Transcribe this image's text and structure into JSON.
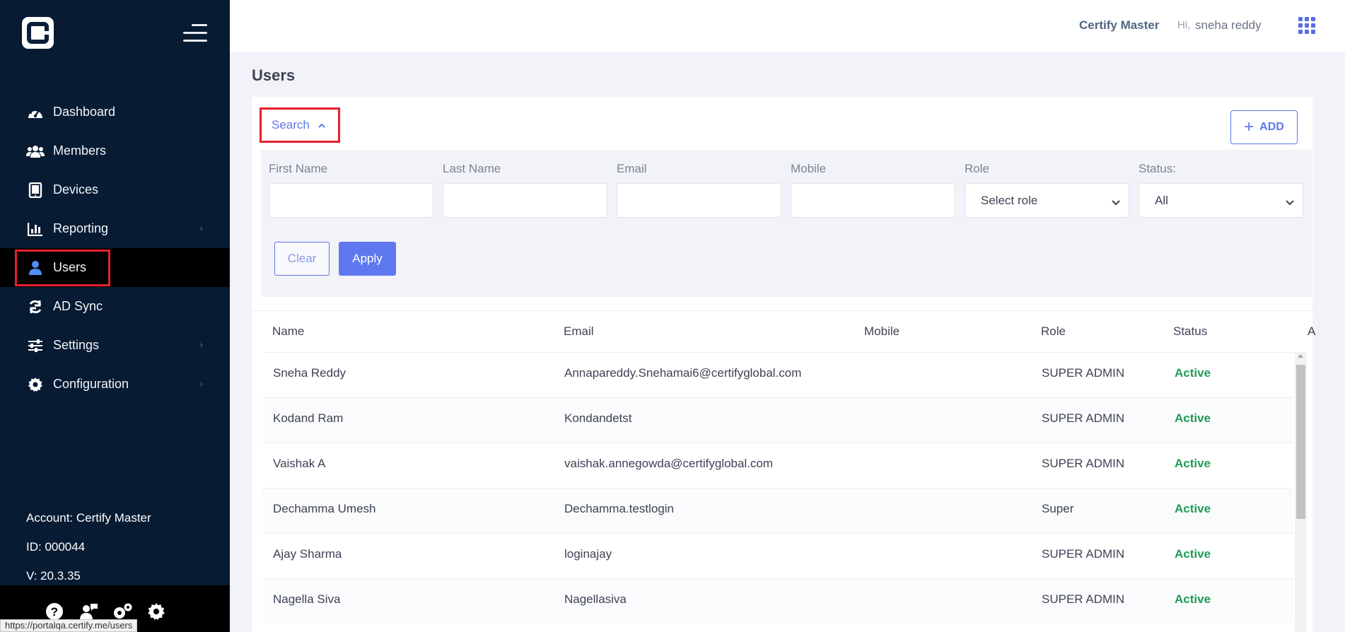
{
  "sidebar": {
    "items": [
      {
        "label": "Dashboard",
        "icon": "dashboard-icon",
        "chevron": false
      },
      {
        "label": "Members",
        "icon": "members-icon",
        "chevron": false
      },
      {
        "label": "Devices",
        "icon": "devices-icon",
        "chevron": false
      },
      {
        "label": "Reporting",
        "icon": "reporting-icon",
        "chevron": true
      },
      {
        "label": "Users",
        "icon": "user-icon",
        "chevron": false,
        "active": true
      },
      {
        "label": "AD Sync",
        "icon": "sync-icon",
        "chevron": false
      },
      {
        "label": "Settings",
        "icon": "sliders-icon",
        "chevron": true
      },
      {
        "label": "Configuration",
        "icon": "gear-icon",
        "chevron": true
      }
    ],
    "account": "Account: Certify Master",
    "id": "ID: 000044",
    "version": "V: 20.3.35",
    "footer_icons": [
      "help-icon",
      "support-user-icon",
      "gears-icon",
      "gear-icon"
    ]
  },
  "status_url": "https://portalqa.certify.me/users",
  "header": {
    "brand": "Certify Master",
    "greeting": "Hi,",
    "user": "sneha reddy",
    "apps_icon": "apps-grid-icon"
  },
  "page": {
    "title": "Users"
  },
  "search": {
    "toggle_label": "Search",
    "add_label": "ADD",
    "filters": [
      {
        "label": "First Name",
        "type": "text",
        "value": ""
      },
      {
        "label": "Last Name",
        "type": "text",
        "value": ""
      },
      {
        "label": "Email",
        "type": "text",
        "value": ""
      },
      {
        "label": "Mobile",
        "type": "text",
        "value": ""
      },
      {
        "label": "Role",
        "type": "select",
        "value": "Select role"
      },
      {
        "label": "Status:",
        "type": "select",
        "value": "All"
      }
    ],
    "clear_label": "Clear",
    "apply_label": "Apply"
  },
  "table": {
    "columns": [
      "Name",
      "Email",
      "Mobile",
      "Role",
      "Status"
    ],
    "cut_column": "A",
    "rows": [
      {
        "name": "Sneha Reddy",
        "email": "Annapareddy.Snehamai6@certifyglobal.com",
        "mobile": "",
        "role": "SUPER ADMIN",
        "status": "Active"
      },
      {
        "name": "Kodand Ram",
        "email": "Kondandetst",
        "mobile": "",
        "role": "SUPER ADMIN",
        "status": "Active"
      },
      {
        "name": "Vaishak A",
        "email": "vaishak.annegowda@certifyglobal.com",
        "mobile": "",
        "role": "SUPER ADMIN",
        "status": "Active"
      },
      {
        "name": "Dechamma Umesh",
        "email": "Dechamma.testlogin",
        "mobile": "",
        "role": "Super",
        "status": "Active"
      },
      {
        "name": "Ajay Sharma",
        "email": "loginajay",
        "mobile": "",
        "role": "SUPER ADMIN",
        "status": "Active"
      },
      {
        "name": "Nagella Siva",
        "email": "Nagellasiva",
        "mobile": "",
        "role": "SUPER ADMIN",
        "status": "Active"
      }
    ]
  },
  "colors": {
    "sidebar_bg": "#071b33",
    "accent": "#5f78f0",
    "highlight_red": "#e5202e",
    "status_active": "#1f9d55"
  }
}
